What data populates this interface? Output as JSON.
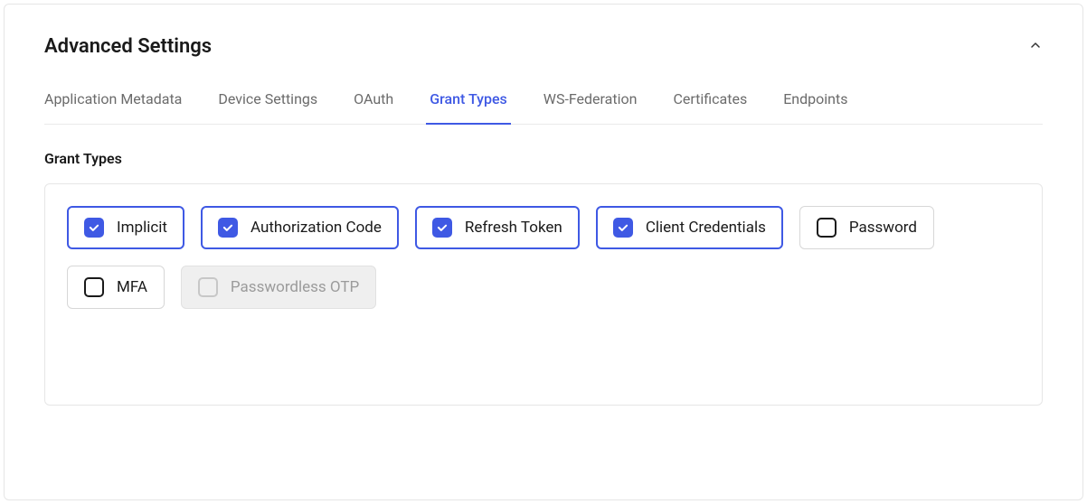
{
  "header": {
    "title": "Advanced Settings"
  },
  "tabs": [
    {
      "label": "Application Metadata",
      "active": false
    },
    {
      "label": "Device Settings",
      "active": false
    },
    {
      "label": "OAuth",
      "active": false
    },
    {
      "label": "Grant Types",
      "active": true
    },
    {
      "label": "WS-Federation",
      "active": false
    },
    {
      "label": "Certificates",
      "active": false
    },
    {
      "label": "Endpoints",
      "active": false
    }
  ],
  "section": {
    "label": "Grant Types"
  },
  "grant_types": [
    {
      "label": "Implicit",
      "checked": true,
      "disabled": false
    },
    {
      "label": "Authorization Code",
      "checked": true,
      "disabled": false
    },
    {
      "label": "Refresh Token",
      "checked": true,
      "disabled": false
    },
    {
      "label": "Client Credentials",
      "checked": true,
      "disabled": false
    },
    {
      "label": "Password",
      "checked": false,
      "disabled": false
    },
    {
      "label": "MFA",
      "checked": false,
      "disabled": false
    },
    {
      "label": "Passwordless OTP",
      "checked": false,
      "disabled": true
    }
  ],
  "colors": {
    "accent": "#3f59e4",
    "border": "#e6e6e6",
    "text": "#1a1a1a",
    "muted": "#6b6b6b",
    "disabled_bg": "#efefef"
  }
}
